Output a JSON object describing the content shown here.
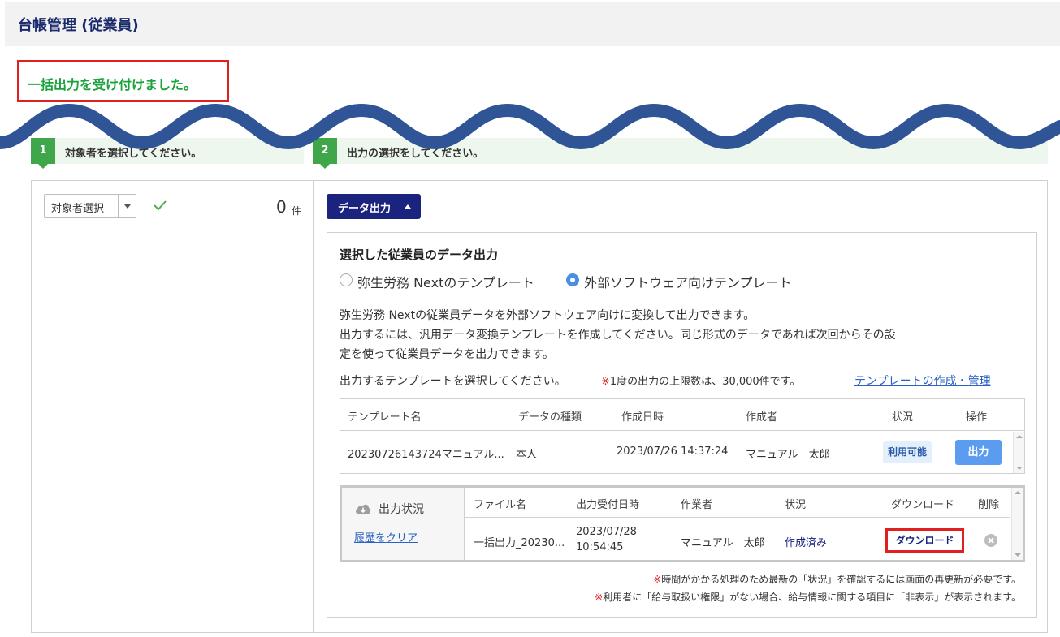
{
  "header": {
    "title": "台帳管理 (従業員)"
  },
  "notice": {
    "message": "一括出力を受け付けました。"
  },
  "steps": [
    {
      "number": "1",
      "label": "対象者を選択してください。"
    },
    {
      "number": "2",
      "label": "出力の選択をしてください。"
    }
  ],
  "target": {
    "select_label": "対象者選択",
    "count": "0",
    "count_unit": "件"
  },
  "export_button": {
    "label": "データ出力"
  },
  "export_panel": {
    "title": "選択した従業員のデータ出力",
    "radio_options": [
      {
        "label": "弥生労務 Nextのテンプレート",
        "checked": false
      },
      {
        "label": "外部ソフトウェア向けテンプレート",
        "checked": true
      }
    ],
    "description_lines": [
      "弥生労務 Nextの従業員データを外部ソフトウェア向けに変換して出力できます。",
      "出力するには、汎用データ変換テンプレートを作成してください。同じ形式のデータであれば次回からその設",
      "定を使って従業員データを出力できます。"
    ],
    "select_prompt": "出力するテンプレートを選択してください。",
    "limit_mark": "※",
    "limit_note": "1度の出力の上限数は、30,000件です。",
    "manage_link": "テンプレートの作成・管理"
  },
  "template_table": {
    "headers": [
      "テンプレート名",
      "データの種類",
      "作成日時",
      "作成者",
      "状況",
      "操作"
    ],
    "rows": [
      {
        "name": "20230726143724マニュアル...",
        "data_type": "本人",
        "created_at": "2023/07/26 14:37:24",
        "creator": "マニュアル　太郎",
        "status": "利用可能",
        "action": "出力"
      }
    ]
  },
  "output_status": {
    "title": "出力状況",
    "clear_link": "履歴をクリア",
    "headers": [
      "ファイル名",
      "出力受付日時",
      "作業者",
      "状況",
      "ダウンロード",
      "削除"
    ],
    "rows": [
      {
        "file_name": "一括出力_20230...",
        "accepted_date": "2023/07/28",
        "accepted_time": "10:54:45",
        "worker": "マニュアル　太郎",
        "status": "作成済み",
        "download": "ダウンロード"
      }
    ]
  },
  "footnotes": [
    {
      "mark": "※",
      "text": "時間がかかる処理のため最新の「状況」を確認するには画面の再更新が必要です。"
    },
    {
      "mark": "※",
      "text": "利用者に「給与取扱い権限」がない場合、給与情報に関する項目に「非表示」が表示されます。"
    }
  ],
  "colors": {
    "brand_navy": "#1a237e",
    "success_green": "#1aa23b",
    "step_green": "#3fa74a",
    "highlight_red": "#e02020",
    "link_blue": "#2962c4",
    "wave_blue": "#2f5597"
  }
}
